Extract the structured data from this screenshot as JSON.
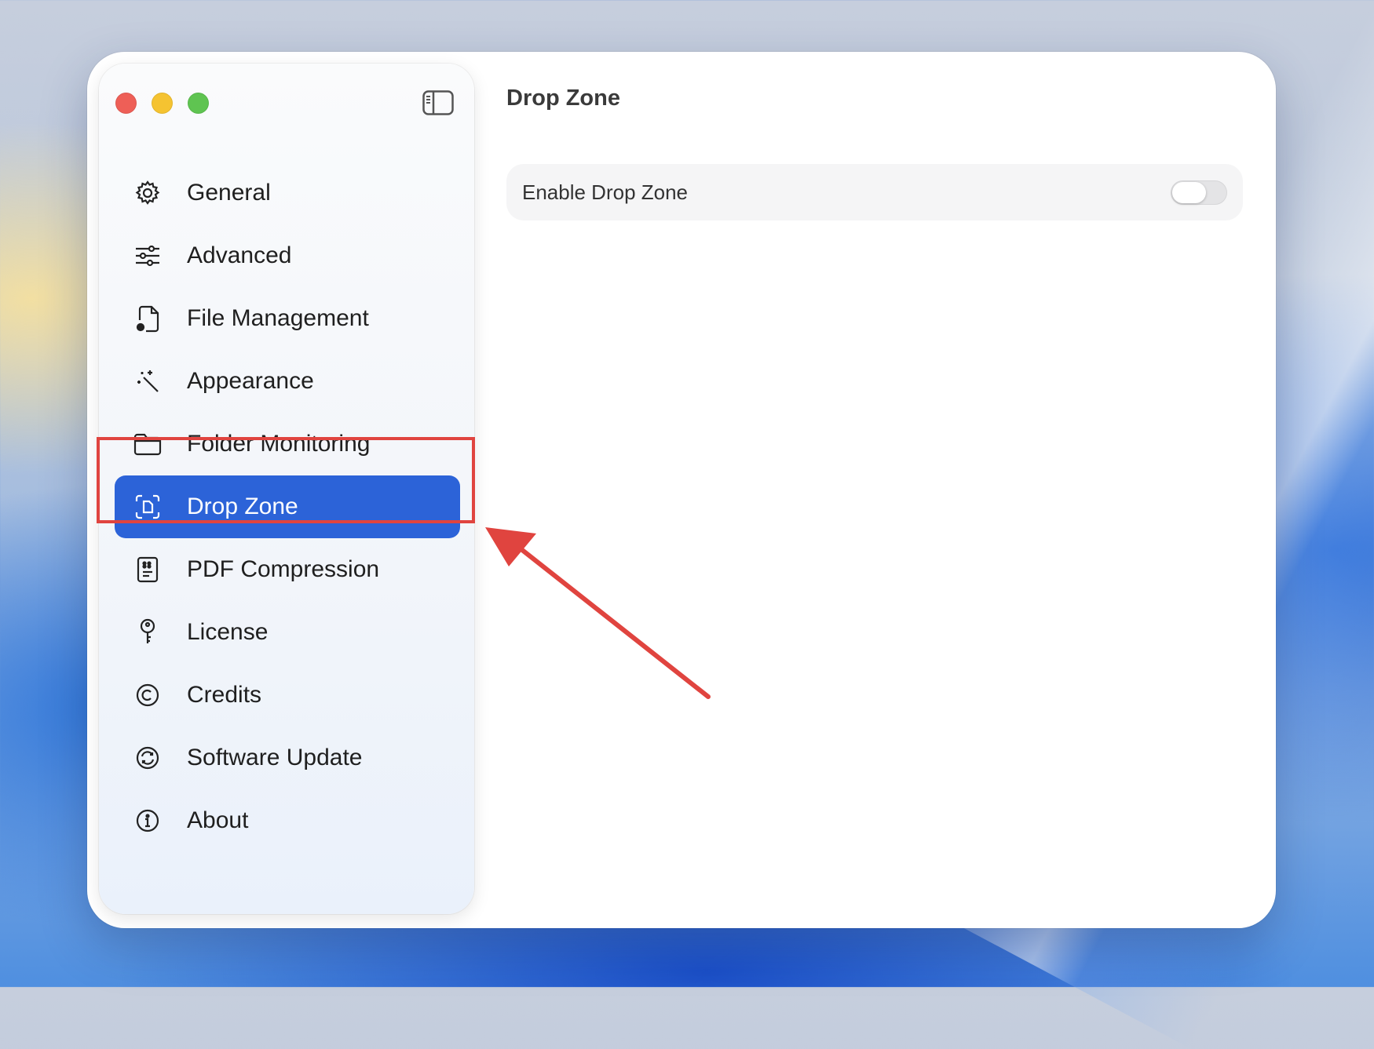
{
  "window": {
    "traffic_lights": [
      "close",
      "minimize",
      "zoom"
    ],
    "sidebar_toggle_icon": "sidebar-toggle-icon"
  },
  "sidebar": {
    "items": [
      {
        "label": "General",
        "icon": "gear-icon",
        "active": false
      },
      {
        "label": "Advanced",
        "icon": "sliders-icon",
        "active": false
      },
      {
        "label": "File Management",
        "icon": "document-gear-icon",
        "active": false
      },
      {
        "label": "Appearance",
        "icon": "magic-wand-icon",
        "active": false
      },
      {
        "label": "Folder Monitoring",
        "icon": "folder-icon",
        "active": false
      },
      {
        "label": "Drop Zone",
        "icon": "drop-zone-icon",
        "active": true
      },
      {
        "label": "PDF Compression",
        "icon": "compressed-doc-icon",
        "active": false
      },
      {
        "label": "License",
        "icon": "key-icon",
        "active": false
      },
      {
        "label": "Credits",
        "icon": "copyright-icon",
        "active": false
      },
      {
        "label": "Software Update",
        "icon": "refresh-circle-icon",
        "active": false
      },
      {
        "label": "About",
        "icon": "info-icon",
        "active": false
      }
    ]
  },
  "main": {
    "title": "Drop Zone",
    "settings": [
      {
        "label": "Enable Drop Zone",
        "enabled": false
      }
    ]
  },
  "annotation": {
    "highlight_color": "#e0443f",
    "accent": "#2c63d8"
  }
}
